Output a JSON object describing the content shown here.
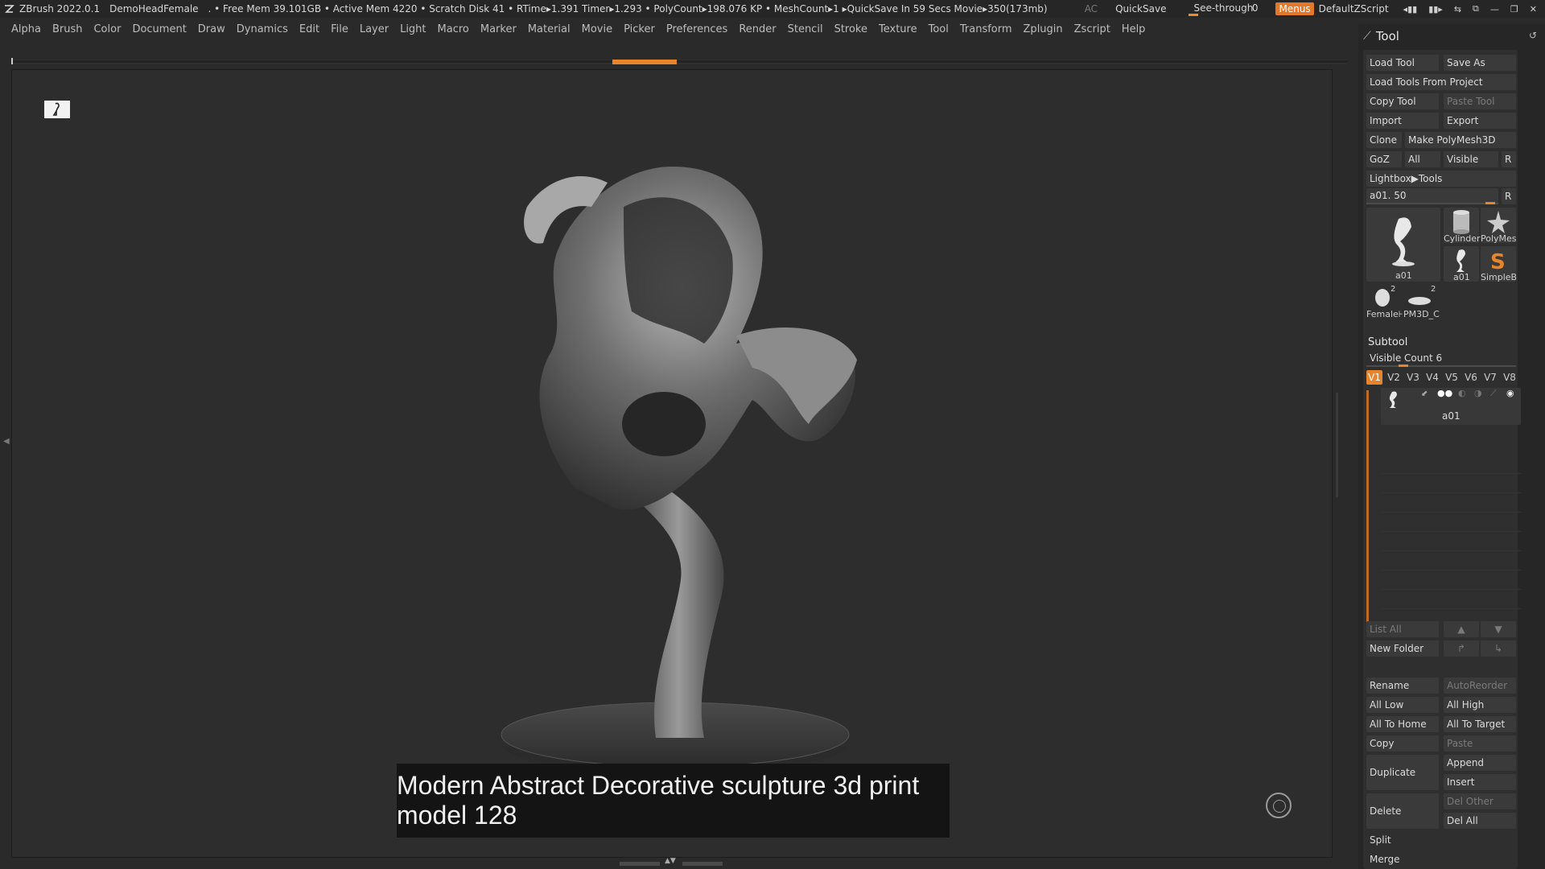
{
  "titlebar": {
    "app": "ZBrush 2022.0.1",
    "document": "DemoHeadFemale",
    "stats": ". • Free Mem 39.101GB • Active Mem 4220 • Scratch Disk 41 •  RTime▸1.391 Timer▸1.293 • PolyCount▸198.076 KP  • MeshCount▸1  ▸QuickSave In 59 Secs Movie▸350(173mb)",
    "ac": "AC",
    "quicksave": "QuickSave",
    "see_through_label": "See-through",
    "see_through_value": "0",
    "see_through_fraction": 0.0,
    "menus": "Menus",
    "default_zscript": "DefaultZScript"
  },
  "menubar": [
    "Alpha",
    "Brush",
    "Color",
    "Document",
    "Draw",
    "Dynamics",
    "Edit",
    "File",
    "Layer",
    "Light",
    "Macro",
    "Marker",
    "Material",
    "Movie",
    "Picker",
    "Preferences",
    "Render",
    "Stencil",
    "Stroke",
    "Texture",
    "Tool",
    "Transform",
    "Zplugin",
    "Zscript",
    "Help"
  ],
  "viewport": {
    "caption": "Modern Abstract Decorative sculpture 3d print model 128"
  },
  "tool_panel": {
    "title": "Tool",
    "load_tool": "Load Tool",
    "save_as": "Save As",
    "load_tools_from_project": "Load Tools From Project",
    "copy_tool": "Copy Tool",
    "paste_tool": "Paste Tool",
    "import": "Import",
    "export": "Export",
    "clone": "Clone",
    "make_polymesh": "Make PolyMesh3D",
    "goz": "GoZ",
    "all": "All",
    "visible": "Visible",
    "r": "R",
    "lightbox_tools": "Lightbox▶Tools",
    "slider_label": "a01. 50",
    "slider_r": "R",
    "thumbs": {
      "main": "a01",
      "cylinder": "Cylinder",
      "polymesh": "PolyMes",
      "a01_small": "a01",
      "simpleb": "SimpleB",
      "female": "Female⊦",
      "pm3d": "PM3D_C",
      "female_badge": "2",
      "pm3d_badge": "2"
    }
  },
  "subtool": {
    "title": "Subtool",
    "visible_count": "Visible Count 6",
    "tabs": [
      "V1",
      "V2",
      "V3",
      "V4",
      "V5",
      "V6",
      "V7",
      "V8"
    ],
    "active_tab": "V1",
    "item_name": "a01",
    "list_all": "List All",
    "new_folder": "New Folder",
    "rename": "Rename",
    "auto_reorder": "AutoReorder",
    "all_low": "All Low",
    "all_high": "All High",
    "all_to_home": "All To Home",
    "all_to_target": "All To Target",
    "copy": "Copy",
    "paste": "Paste",
    "duplicate": "Duplicate",
    "append": "Append",
    "insert": "Insert",
    "delete": "Delete",
    "del_other": "Del Other",
    "del_all": "Del All",
    "split": "Split",
    "merge": "Merge"
  },
  "colors": {
    "accent": "#e8852c",
    "background": "#2a2a2a",
    "panel": "#262626"
  }
}
